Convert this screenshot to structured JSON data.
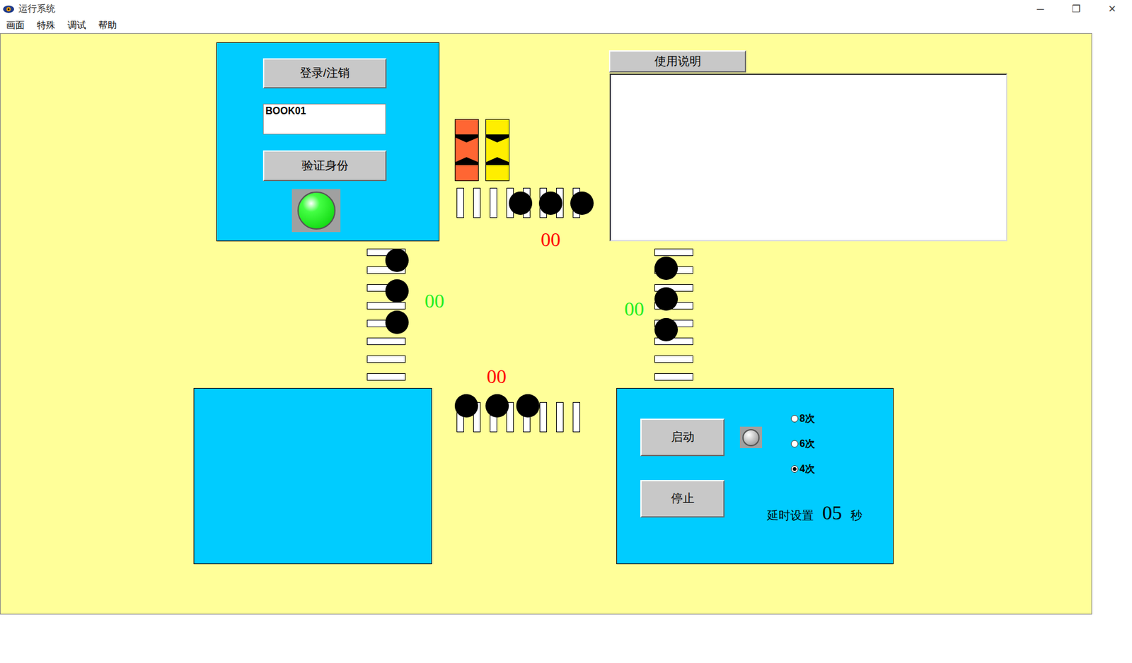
{
  "window": {
    "title": "运行系统",
    "controls": [
      "─",
      "❐",
      "✕"
    ]
  },
  "menu": [
    "画面",
    "特殊",
    "调试",
    "帮助"
  ],
  "login_panel": {
    "login_button": "登录/注销",
    "user_field": "BOOK01",
    "verify_button": "验证身份",
    "indicator_on": true
  },
  "signals": [
    {
      "name": "red-amber",
      "color": "#ff6633"
    },
    {
      "name": "amber",
      "color": "#ffee00"
    }
  ],
  "crossings": [
    {
      "name": "north",
      "kind": "horizontal",
      "counter": "00",
      "counter_color": "#ff0000",
      "pedestrians": 3
    },
    {
      "name": "west",
      "kind": "vertical",
      "counter": "00",
      "counter_color": "#22ee22",
      "pedestrians": 3
    },
    {
      "name": "east",
      "kind": "vertical",
      "counter": "00",
      "counter_color": "#22ee22",
      "pedestrians": 3
    },
    {
      "name": "south",
      "kind": "horizontal",
      "counter": "00",
      "counter_color": "#ff0000",
      "pedestrians": 3
    }
  ],
  "usage": {
    "tab": "使用说明",
    "text": ""
  },
  "control_panel": {
    "start_button": "启动",
    "stop_button": "停止",
    "indicator_on": false,
    "cycles": [
      {
        "label": "8次",
        "selected": false
      },
      {
        "label": "6次",
        "selected": false
      },
      {
        "label": "4次",
        "selected": true
      }
    ],
    "delay_label": "延时设置",
    "delay_value": "05",
    "delay_unit": "秒"
  }
}
